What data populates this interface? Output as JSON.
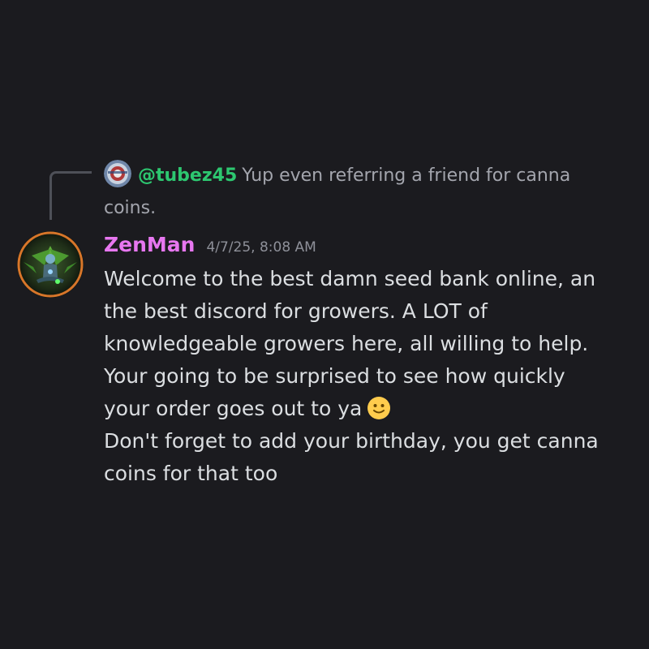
{
  "reply": {
    "username": "@tubez45",
    "text_line1": "Yup even referring a friend for canna",
    "text_line2": "coins."
  },
  "message": {
    "username": "ZenMan",
    "timestamp": "4/7/25, 8:08 AM",
    "lines": [
      "Welcome to the best damn seed bank online, an",
      "the best discord for growers. A LOT of",
      "knowledgeable growers here, all willing to help.",
      "Your going to be surprised to see how quickly",
      "your order goes out to ya",
      "Don't forget to add your birthday, you get canna",
      "coins for that too"
    ],
    "emoji": "slightly-smiling-face"
  },
  "colors": {
    "background": "#1b1b1f",
    "username_main": "#e777f0",
    "username_reply": "#2dc770",
    "text": "#dbdee1",
    "muted": "#a3a5ad"
  }
}
